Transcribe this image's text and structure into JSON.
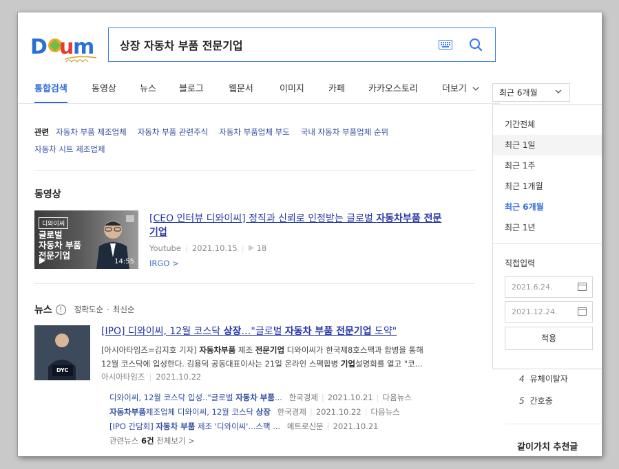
{
  "search": {
    "query": "상장 자동차 부품 전문기업"
  },
  "tabs": [
    {
      "label": "통합검색",
      "active": true
    },
    {
      "label": "동영상"
    },
    {
      "label": "뉴스"
    },
    {
      "label": "블로그"
    },
    {
      "label": "웹문서"
    },
    {
      "label": "이미지"
    },
    {
      "label": "카페"
    },
    {
      "label": "카카오스토리"
    },
    {
      "label": "더보기"
    }
  ],
  "period_select": {
    "selected": "최근 6개월"
  },
  "related": {
    "label": "관련",
    "links": [
      "자동차 부품 제조업체",
      "자동차 부품 관련주식",
      "자동차 부품업체 부도",
      "국내 자동차 부품업체 순위",
      "자동차 시트 제조업체"
    ]
  },
  "video": {
    "section_title": "동영상",
    "thumb_tag": "디와이씨",
    "thumb_line1": "글로벌",
    "thumb_line2": "자동차 부품",
    "thumb_line3": "전문기업",
    "duration": "14:55",
    "title_pre": "[CEO 인터뷰 디와이씨] 정직과 신뢰로 인정받는 글로벌 ",
    "title_bold": "자동차부품 전문",
    "title_line2": "기업",
    "source": "Youtube",
    "date": "2021.10.15",
    "views": "18",
    "channel": "IRGO >"
  },
  "news": {
    "section_title": "뉴스",
    "sort_accuracy": "정확도순",
    "sort_dot": "·",
    "sort_latest": "최신순",
    "thumb_label": "DYC",
    "title_pre": "[IPO] 디와이씨, 12월 코스닥 ",
    "title_bold1": "상장",
    "title_mid": "…\"글로벌 ",
    "title_bold2": "자동차 부품 전문기업",
    "title_post": " 도약\"",
    "desc_1": "[아시아타임즈=김지호 기자] ",
    "desc_b1": "자동차부품",
    "desc_2": " 제조 ",
    "desc_b2": "전문기업",
    "desc_3": " 디와이씨가 한국제8호스팩과 합병을 통해",
    "desc_4": "12월 코스닥에 입성한다. 김용덕 공동대표이사는 21일 온라인 스팩합병 ",
    "desc_b3": "기업",
    "desc_5": "설명회를 열고 \"코...",
    "source": "아시아타임즈",
    "date": "2021.10.22",
    "related": [
      {
        "pre": "디와이씨, 12월 코스닥 입성..\"글로벌 ",
        "bold": "자동차 부품",
        "post": "...",
        "source": "한국경제",
        "date": "2021.10.21",
        "portal": "다음뉴스"
      },
      {
        "pre": "",
        "bold": "자동차부품",
        "post": "제조업체 디와이씨, 12월 코스닥 ",
        "bold2": "상장",
        "source": "한국경제",
        "date": "2021.10.22",
        "portal": "다음뉴스"
      },
      {
        "pre": "[IPO 간담회] ",
        "bold": "자동차 부품",
        "post": " 제조 '디와이씨'...스팩 ...",
        "source": "메트로신문",
        "date": "2021.10.21",
        "portal": ""
      }
    ],
    "more_pre": "관련뉴스 ",
    "more_count": "6건",
    "more_post": " 전체보기 >"
  },
  "dropdown": {
    "items": [
      "기간전체",
      "최근 1일",
      "최근 1주",
      "최근 1개월",
      "최근 6개월",
      "최근 1년"
    ],
    "active_item": "최근 6개월",
    "custom_label": "직접입력",
    "start_date": "2021.6.24.",
    "end_date": "2021.12.24.",
    "apply": "적용"
  },
  "sidebar": {
    "ranks": [
      {
        "num": "4",
        "label": "유체이탈자"
      },
      {
        "num": "5",
        "label": "간호중"
      }
    ],
    "bottom_title": "같이가치 추천글"
  },
  "colors": {
    "accent": "#2f6be0",
    "link": "#2637a7"
  }
}
